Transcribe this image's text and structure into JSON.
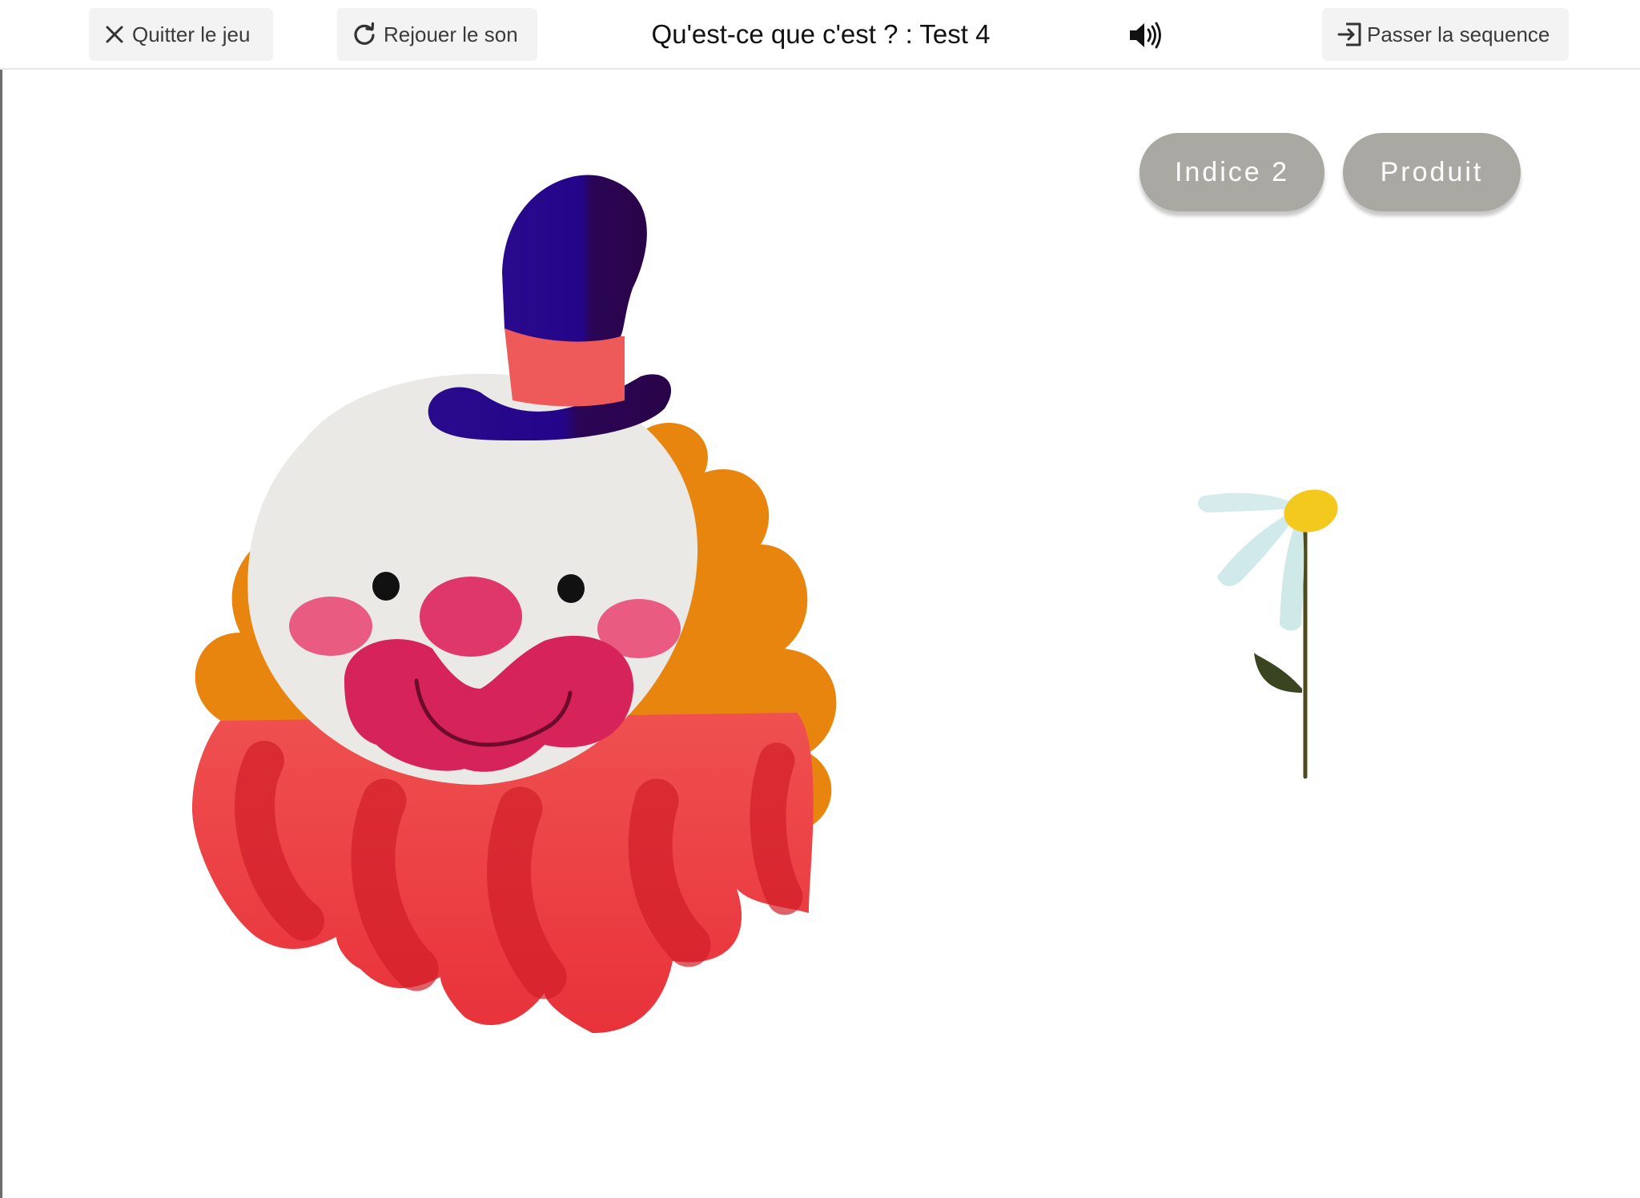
{
  "toolbar": {
    "quit_label": "Quitter le jeu",
    "replay_label": "Rejouer le son",
    "title": "Qu'est-ce que c'est ? : Test 4",
    "skip_label": "Passer la sequence"
  },
  "answers": {
    "hint_label": "Indice 2",
    "product_label": "Produit"
  },
  "icons": {
    "quit": "close-icon",
    "replay": "refresh-icon",
    "volume": "volume-icon",
    "skip": "exit-icon"
  },
  "colors": {
    "pill_background": "#aaa8a3",
    "toolbar_button_background": "#f3f3f3",
    "hat": "#2a0a8c",
    "hat_band": "#ee5a5a",
    "hair": "#e8850f",
    "nose_cheeks": "#e0376a",
    "collar": "#e8323a",
    "petals": "#d6ecec",
    "flower_center": "#f2c91c"
  }
}
